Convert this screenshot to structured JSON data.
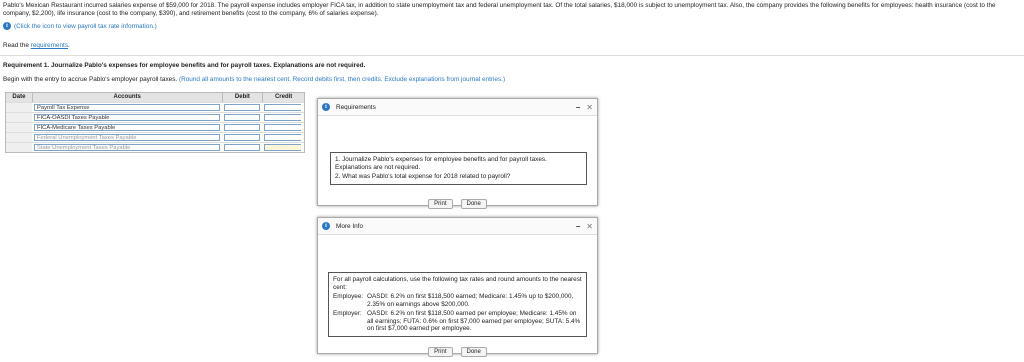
{
  "problem": {
    "text": "Pablo's Mexican Restaurant incurred salaries expense of $59,000 for 2018. The payroll expense includes employer FICA tax, in addition to state unemployment tax and federal unemployment tax. Of the total salaries, $18,000 is subject to unemployment tax. Also, the company provides the following benefits for employees: health insurance (cost to the company, $2,200), life insurance (cost to the company, $390), and retirement benefits (cost to the company, 6% of salaries expense)."
  },
  "hint": {
    "text": "(Click the icon to view payroll tax rate information.)"
  },
  "read": {
    "prefix": "Read the ",
    "link": "requirements",
    "suffix": "."
  },
  "requirement": {
    "title": "Requirement 1. Journalize Pablo's expenses for employee benefits and for payroll taxes. Explanations are not required.",
    "begin": "Begin with the entry to accrue Pablo's employer payroll taxes.",
    "instructions": "(Round all amounts to the nearest cent. Record debits first, then credits. Exclude explanations from journal entries.)"
  },
  "journal": {
    "headers": {
      "date": "Date",
      "accounts": "Accounts",
      "debit": "Debit",
      "credit": "Credit"
    },
    "rows": [
      {
        "account": "Payroll Tax Expense"
      },
      {
        "account": "FICA-OASDI Taxes Payable"
      },
      {
        "account": "FICA-Medicare Taxes Payable"
      },
      {
        "account": "Federal Unemployment Taxes Payable"
      },
      {
        "account": "State Unemployment Taxes Payable"
      }
    ]
  },
  "requirements_popup": {
    "title": "Requirements",
    "item1": "1. Journalize Pablo's expenses for employee benefits and for payroll taxes. Explanations are not required.",
    "item2": "2. What was Pablo's total expense for 2018 related to payroll?",
    "print": "Print",
    "done": "Done"
  },
  "moreinfo_popup": {
    "title": "More Info",
    "intro": "For all payroll calculations, use the following tax rates and round amounts to the nearest cent:",
    "employee_label": "Employee:",
    "employee_text": "OASDI: 6.2% on first $118,500 earned; Medicare: 1.45% up to $200,000, 2.35% on earnings above $200,000.",
    "employer_label": "Employer:",
    "employer_text": "OASDI: 6.2% on first $118,500 earned per employee; Medicare: 1.45% on all earnings; FUTA: 0.6% on first $7,000 earned per employee; SUTA: 5.4% on first $7,000 earned per employee.",
    "print": "Print",
    "done": "Done"
  }
}
